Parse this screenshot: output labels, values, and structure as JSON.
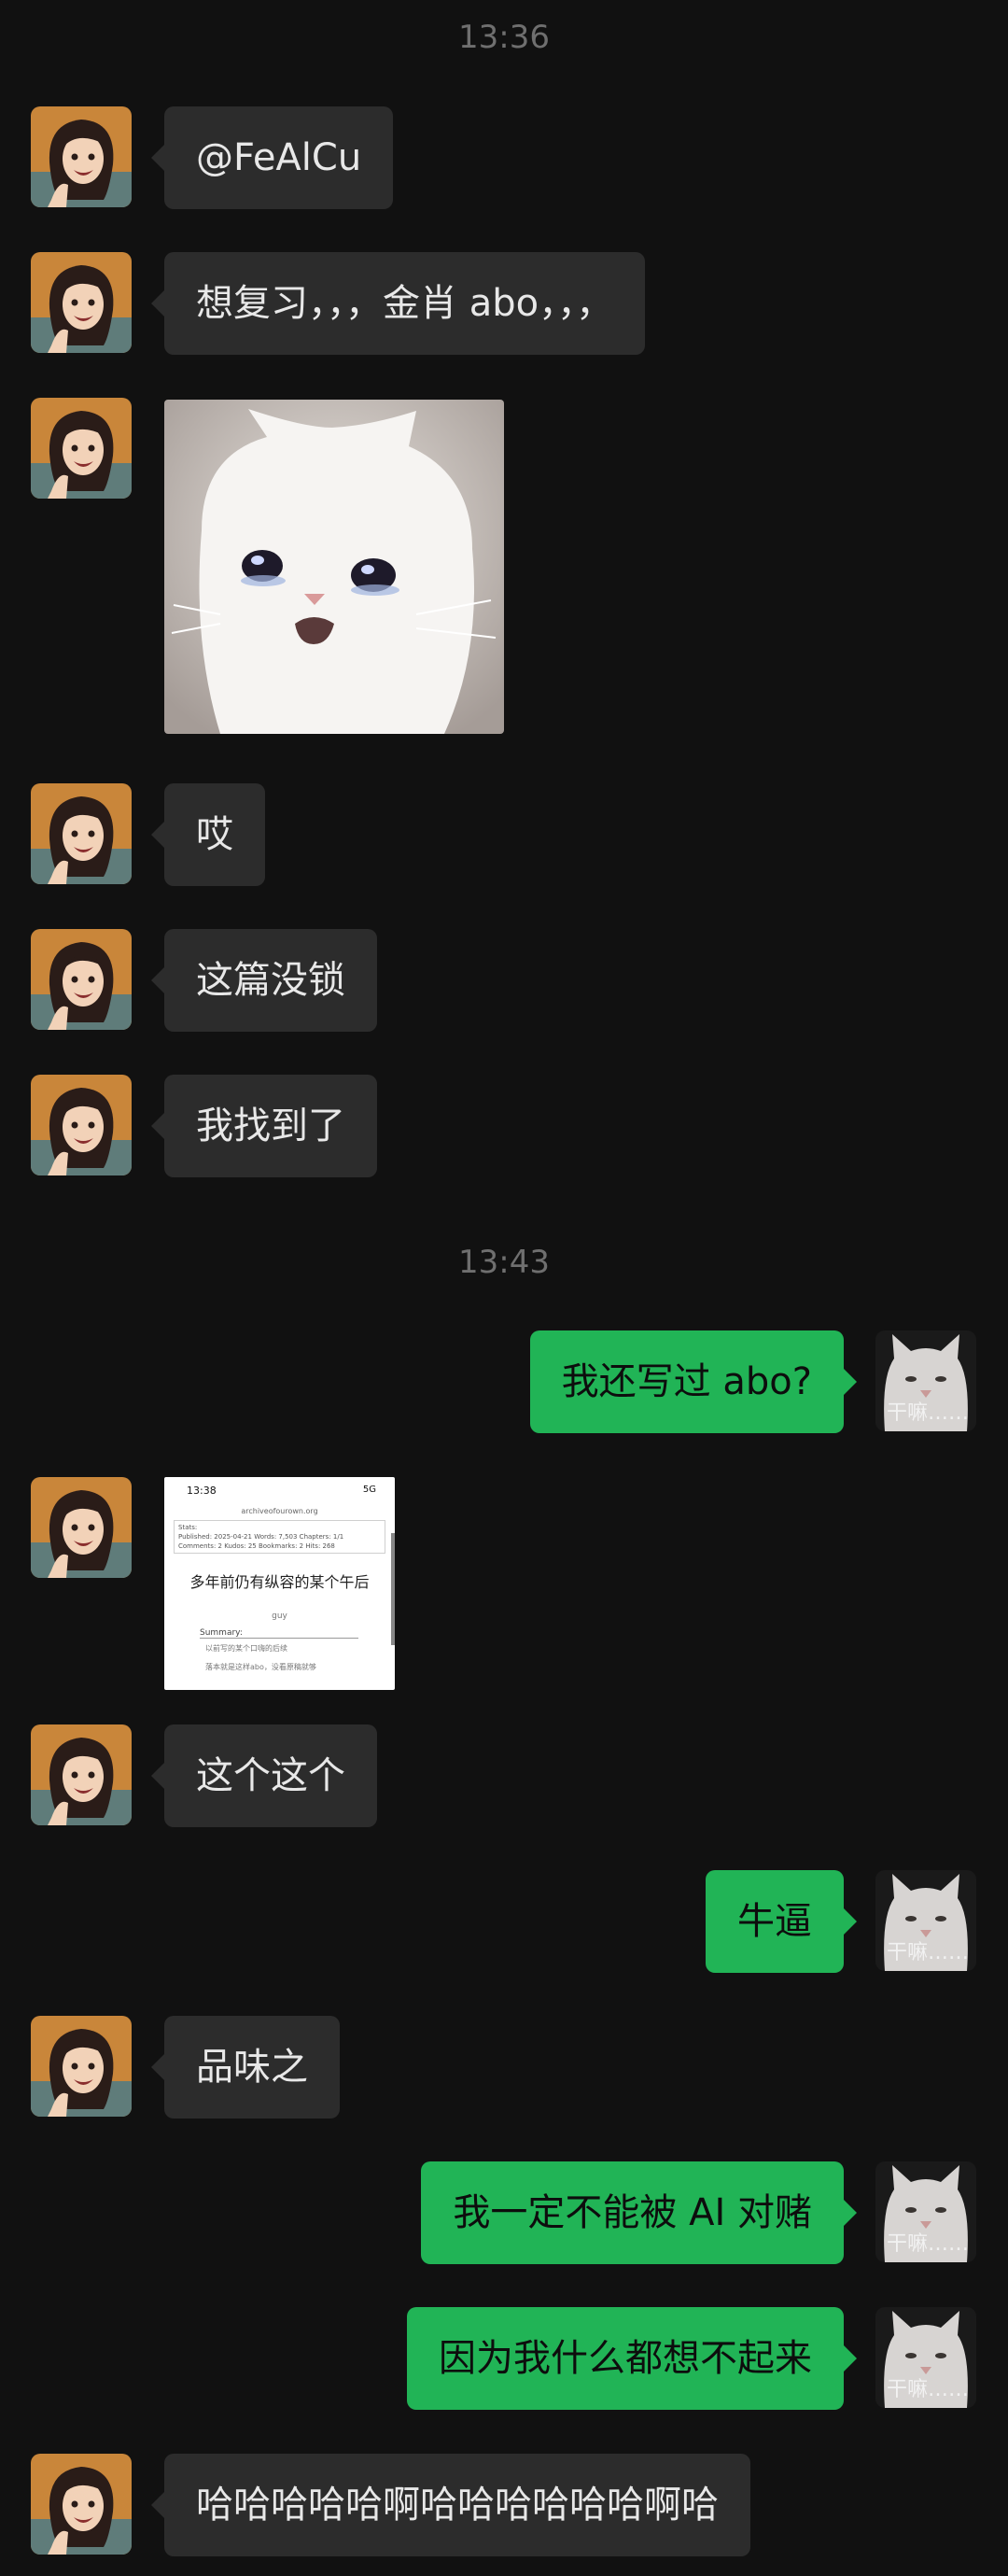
{
  "timestamps": [
    "13:36",
    "13:43"
  ],
  "contact": {
    "avatar_icon": "cartoon-girl-avatar-icon"
  },
  "me": {
    "avatar_icon": "white-cat-avatar-icon",
    "avatar_label": "干嘛……"
  },
  "colors": {
    "background": "#111111",
    "incoming_bubble": "#2c2c2c",
    "outgoing_bubble": "#21b456"
  },
  "messages": [
    {
      "from": "contact",
      "text": "@FeAlCu"
    },
    {
      "from": "contact",
      "text": "想复习，，，金肖 abo，，，"
    },
    {
      "from": "contact",
      "sticker": "crying-white-cat-sticker"
    },
    {
      "from": "contact",
      "text": "哎"
    },
    {
      "from": "contact",
      "text": "这篇没锁"
    },
    {
      "from": "contact",
      "text": "我找到了"
    },
    {
      "from": "me",
      "text": "我还写过 abo?"
    },
    {
      "from": "contact",
      "image": "archive-of-our-own-screenshot"
    },
    {
      "from": "contact",
      "text": "这个这个"
    },
    {
      "from": "me",
      "text": "牛逼"
    },
    {
      "from": "contact",
      "text": "品味之"
    },
    {
      "from": "me",
      "text": "我一定不能被 AI 对赌"
    },
    {
      "from": "me",
      "text": "因为我什么都想不起来"
    },
    {
      "from": "contact",
      "text": "哈哈哈哈哈啊哈哈哈哈哈哈啊哈"
    }
  ],
  "screenshot": {
    "status_time": "13:38",
    "status_right": "5G",
    "url": "archiveofourown.org",
    "stats_line1": "Stats:",
    "stats_line2": "Published: 2025-04-21   Words: 7,503   Chapters: 1/1",
    "stats_line3": "Comments: 2   Kudos: 25   Bookmarks: 2   Hits: 268",
    "title": "多年前仍有纵容的某个午后",
    "author": "guy",
    "summary_label": "Summary:",
    "line1": "以前写的某个口嗨的后续",
    "line2": "落本就是这样abo，没看原稿就够"
  }
}
